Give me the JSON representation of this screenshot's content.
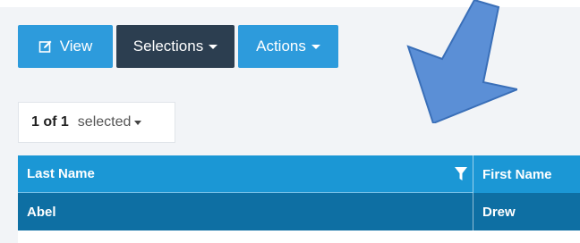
{
  "toolbar": {
    "view_label": "View",
    "selections_label": "Selections",
    "actions_label": "Actions"
  },
  "selection": {
    "count": "1 of 1",
    "word": "selected"
  },
  "grid": {
    "columns": [
      "Last Name",
      "First Name"
    ],
    "rows": [
      [
        "Abel",
        "Drew"
      ]
    ]
  },
  "colors": {
    "primary": "#2d9bdc",
    "dark": "#2c3e50",
    "header": "#1b97d5",
    "selected_row": "#0e6fa3",
    "arrow": "#5b8fd6"
  }
}
